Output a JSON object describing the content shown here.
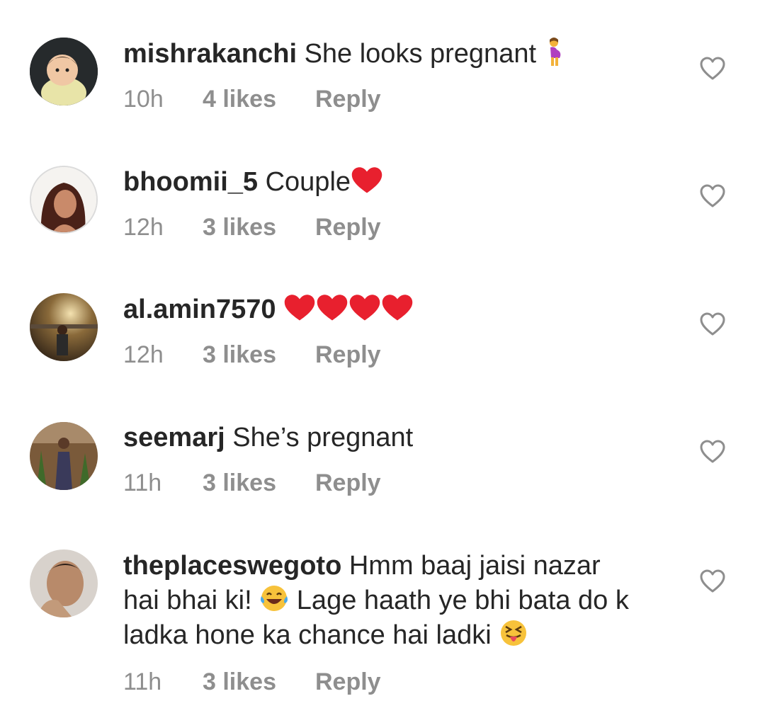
{
  "comments": [
    {
      "username": "mishrakanchi",
      "text": "She looks pregnant",
      "emoji": "pregnant-woman",
      "time": "10h",
      "likes": "4 likes",
      "reply": "Reply"
    },
    {
      "username": "bhoomii_5",
      "text": "Couple",
      "emoji": "red-heart",
      "time": "12h",
      "likes": "3 likes",
      "reply": "Reply"
    },
    {
      "username": "al.amin7570",
      "text": "",
      "emoji": "red-heart x4",
      "time": "12h",
      "likes": "3 likes",
      "reply": "Reply"
    },
    {
      "username": "seemarj",
      "text": "She’s pregnant",
      "time": "11h",
      "likes": "3 likes",
      "reply": "Reply"
    },
    {
      "username": "theplaceswegoto",
      "line1": "Hmm baaj jaisi nazar",
      "line2a": "hai bhai ki!",
      "line2b": "Lage haath ye bhi bata do k",
      "line3": "ladka hone ka chance hai ladki",
      "emojis": [
        "face-with-tears-of-joy",
        "squinting-face-with-tongue"
      ],
      "time": "11h",
      "likes": "3 likes",
      "reply": "Reply"
    }
  ],
  "colors": {
    "text": "#262626",
    "meta": "#8e8e8e",
    "heart_emoji": "#e8202e",
    "icon": "#8e8e8e"
  }
}
